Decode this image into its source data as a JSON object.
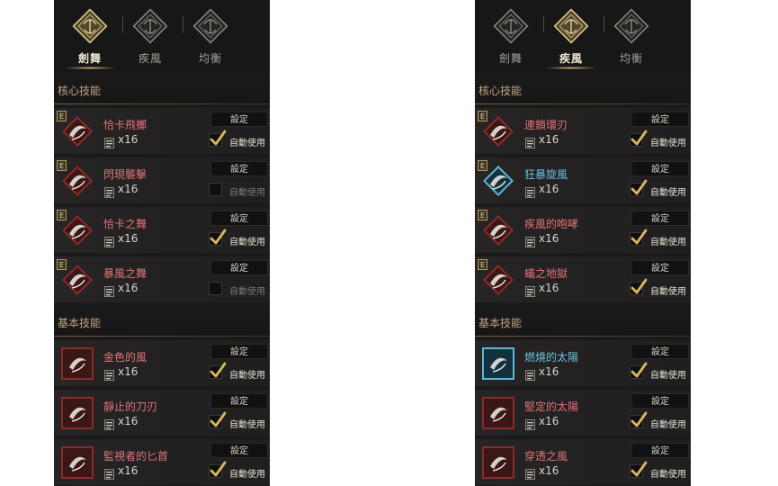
{
  "panels": [
    {
      "tabs": [
        {
          "label": "劍舞"
        },
        {
          "label": "疾風"
        },
        {
          "label": "均衡"
        }
      ],
      "active_tab": 0,
      "core_header": "核心技能",
      "basic_header": "基本技能",
      "core": [
        {
          "name": "恰卡飛擲",
          "color": "red",
          "count": "x16",
          "set": "設定",
          "auto": "自動使用",
          "checked": true,
          "icon": "chakram-throw-icon",
          "grade": "E"
        },
        {
          "name": "閃現襲擊",
          "color": "red",
          "count": "x16",
          "set": "設定",
          "auto": "自動使用",
          "checked": false,
          "icon": "flash-strike-icon",
          "grade": "E"
        },
        {
          "name": "恰卡之舞",
          "color": "red",
          "count": "x16",
          "set": "設定",
          "auto": "自動使用",
          "checked": true,
          "icon": "chakram-dance-icon",
          "grade": "E"
        },
        {
          "name": "暴風之舞",
          "color": "red",
          "count": "x16",
          "set": "設定",
          "auto": "自動使用",
          "checked": false,
          "icon": "storm-dance-icon",
          "grade": "E"
        }
      ],
      "basic": [
        {
          "name": "金色的風",
          "color": "red",
          "count": "x16",
          "set": "設定",
          "auto": "自動使用",
          "checked": true,
          "icon": "golden-wind-icon"
        },
        {
          "name": "靜止的刀刃",
          "color": "red",
          "count": "x16",
          "set": "設定",
          "auto": "自動使用",
          "checked": true,
          "icon": "still-blade-icon"
        },
        {
          "name": "監視者的匕首",
          "color": "red",
          "count": "x16",
          "set": "設定",
          "auto": "自動使用",
          "checked": true,
          "icon": "watcher-dagger-icon"
        }
      ]
    },
    {
      "tabs": [
        {
          "label": "劍舞"
        },
        {
          "label": "疾風"
        },
        {
          "label": "均衡"
        }
      ],
      "active_tab": 1,
      "core_header": "核心技能",
      "basic_header": "基本技能",
      "core": [
        {
          "name": "連鎖環刃",
          "color": "red",
          "count": "x16",
          "set": "設定",
          "auto": "自動使用",
          "checked": true,
          "icon": "chain-ring-blade-icon",
          "grade": "E"
        },
        {
          "name": "狂暴旋風",
          "color": "blue",
          "count": "x16",
          "set": "設定",
          "auto": "自動使用",
          "checked": true,
          "icon": "raging-whirlwind-icon",
          "grade": "E"
        },
        {
          "name": "疾風的咆哮",
          "color": "red",
          "count": "x16",
          "set": "設定",
          "auto": "自動使用",
          "checked": true,
          "icon": "gale-roar-icon",
          "grade": "E"
        },
        {
          "name": "蟻之地獄",
          "color": "red",
          "count": "x16",
          "set": "設定",
          "auto": "自動使用",
          "checked": true,
          "icon": "ant-hell-icon",
          "grade": "E"
        }
      ],
      "basic": [
        {
          "name": "燃燒的太陽",
          "color": "blue",
          "count": "x16",
          "set": "設定",
          "auto": "自動使用",
          "checked": true,
          "icon": "burning-sun-icon"
        },
        {
          "name": "堅定的太陽",
          "color": "red",
          "count": "x16",
          "set": "設定",
          "auto": "自動使用",
          "checked": true,
          "icon": "steadfast-sun-icon"
        },
        {
          "name": "穿透之風",
          "color": "red",
          "count": "x16",
          "set": "設定",
          "auto": "自動使用",
          "checked": true,
          "icon": "piercing-wind-icon"
        }
      ]
    }
  ]
}
